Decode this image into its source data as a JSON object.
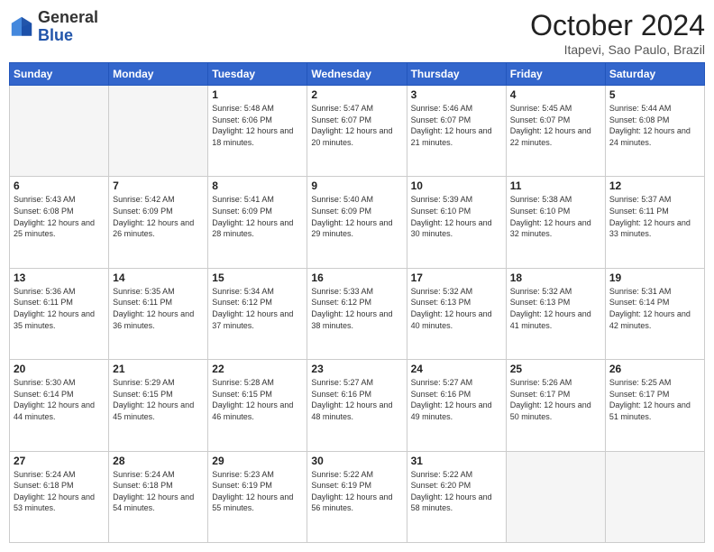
{
  "logo": {
    "general": "General",
    "blue": "Blue"
  },
  "header": {
    "month": "October 2024",
    "location": "Itapevi, Sao Paulo, Brazil"
  },
  "days_of_week": [
    "Sunday",
    "Monday",
    "Tuesday",
    "Wednesday",
    "Thursday",
    "Friday",
    "Saturday"
  ],
  "weeks": [
    [
      {
        "day": "",
        "empty": true
      },
      {
        "day": "",
        "empty": true
      },
      {
        "day": "1",
        "sunrise": "Sunrise: 5:48 AM",
        "sunset": "Sunset: 6:06 PM",
        "daylight": "Daylight: 12 hours and 18 minutes."
      },
      {
        "day": "2",
        "sunrise": "Sunrise: 5:47 AM",
        "sunset": "Sunset: 6:07 PM",
        "daylight": "Daylight: 12 hours and 20 minutes."
      },
      {
        "day": "3",
        "sunrise": "Sunrise: 5:46 AM",
        "sunset": "Sunset: 6:07 PM",
        "daylight": "Daylight: 12 hours and 21 minutes."
      },
      {
        "day": "4",
        "sunrise": "Sunrise: 5:45 AM",
        "sunset": "Sunset: 6:07 PM",
        "daylight": "Daylight: 12 hours and 22 minutes."
      },
      {
        "day": "5",
        "sunrise": "Sunrise: 5:44 AM",
        "sunset": "Sunset: 6:08 PM",
        "daylight": "Daylight: 12 hours and 24 minutes."
      }
    ],
    [
      {
        "day": "6",
        "sunrise": "Sunrise: 5:43 AM",
        "sunset": "Sunset: 6:08 PM",
        "daylight": "Daylight: 12 hours and 25 minutes."
      },
      {
        "day": "7",
        "sunrise": "Sunrise: 5:42 AM",
        "sunset": "Sunset: 6:09 PM",
        "daylight": "Daylight: 12 hours and 26 minutes."
      },
      {
        "day": "8",
        "sunrise": "Sunrise: 5:41 AM",
        "sunset": "Sunset: 6:09 PM",
        "daylight": "Daylight: 12 hours and 28 minutes."
      },
      {
        "day": "9",
        "sunrise": "Sunrise: 5:40 AM",
        "sunset": "Sunset: 6:09 PM",
        "daylight": "Daylight: 12 hours and 29 minutes."
      },
      {
        "day": "10",
        "sunrise": "Sunrise: 5:39 AM",
        "sunset": "Sunset: 6:10 PM",
        "daylight": "Daylight: 12 hours and 30 minutes."
      },
      {
        "day": "11",
        "sunrise": "Sunrise: 5:38 AM",
        "sunset": "Sunset: 6:10 PM",
        "daylight": "Daylight: 12 hours and 32 minutes."
      },
      {
        "day": "12",
        "sunrise": "Sunrise: 5:37 AM",
        "sunset": "Sunset: 6:11 PM",
        "daylight": "Daylight: 12 hours and 33 minutes."
      }
    ],
    [
      {
        "day": "13",
        "sunrise": "Sunrise: 5:36 AM",
        "sunset": "Sunset: 6:11 PM",
        "daylight": "Daylight: 12 hours and 35 minutes."
      },
      {
        "day": "14",
        "sunrise": "Sunrise: 5:35 AM",
        "sunset": "Sunset: 6:11 PM",
        "daylight": "Daylight: 12 hours and 36 minutes."
      },
      {
        "day": "15",
        "sunrise": "Sunrise: 5:34 AM",
        "sunset": "Sunset: 6:12 PM",
        "daylight": "Daylight: 12 hours and 37 minutes."
      },
      {
        "day": "16",
        "sunrise": "Sunrise: 5:33 AM",
        "sunset": "Sunset: 6:12 PM",
        "daylight": "Daylight: 12 hours and 38 minutes."
      },
      {
        "day": "17",
        "sunrise": "Sunrise: 5:32 AM",
        "sunset": "Sunset: 6:13 PM",
        "daylight": "Daylight: 12 hours and 40 minutes."
      },
      {
        "day": "18",
        "sunrise": "Sunrise: 5:32 AM",
        "sunset": "Sunset: 6:13 PM",
        "daylight": "Daylight: 12 hours and 41 minutes."
      },
      {
        "day": "19",
        "sunrise": "Sunrise: 5:31 AM",
        "sunset": "Sunset: 6:14 PM",
        "daylight": "Daylight: 12 hours and 42 minutes."
      }
    ],
    [
      {
        "day": "20",
        "sunrise": "Sunrise: 5:30 AM",
        "sunset": "Sunset: 6:14 PM",
        "daylight": "Daylight: 12 hours and 44 minutes."
      },
      {
        "day": "21",
        "sunrise": "Sunrise: 5:29 AM",
        "sunset": "Sunset: 6:15 PM",
        "daylight": "Daylight: 12 hours and 45 minutes."
      },
      {
        "day": "22",
        "sunrise": "Sunrise: 5:28 AM",
        "sunset": "Sunset: 6:15 PM",
        "daylight": "Daylight: 12 hours and 46 minutes."
      },
      {
        "day": "23",
        "sunrise": "Sunrise: 5:27 AM",
        "sunset": "Sunset: 6:16 PM",
        "daylight": "Daylight: 12 hours and 48 minutes."
      },
      {
        "day": "24",
        "sunrise": "Sunrise: 5:27 AM",
        "sunset": "Sunset: 6:16 PM",
        "daylight": "Daylight: 12 hours and 49 minutes."
      },
      {
        "day": "25",
        "sunrise": "Sunrise: 5:26 AM",
        "sunset": "Sunset: 6:17 PM",
        "daylight": "Daylight: 12 hours and 50 minutes."
      },
      {
        "day": "26",
        "sunrise": "Sunrise: 5:25 AM",
        "sunset": "Sunset: 6:17 PM",
        "daylight": "Daylight: 12 hours and 51 minutes."
      }
    ],
    [
      {
        "day": "27",
        "sunrise": "Sunrise: 5:24 AM",
        "sunset": "Sunset: 6:18 PM",
        "daylight": "Daylight: 12 hours and 53 minutes."
      },
      {
        "day": "28",
        "sunrise": "Sunrise: 5:24 AM",
        "sunset": "Sunset: 6:18 PM",
        "daylight": "Daylight: 12 hours and 54 minutes."
      },
      {
        "day": "29",
        "sunrise": "Sunrise: 5:23 AM",
        "sunset": "Sunset: 6:19 PM",
        "daylight": "Daylight: 12 hours and 55 minutes."
      },
      {
        "day": "30",
        "sunrise": "Sunrise: 5:22 AM",
        "sunset": "Sunset: 6:19 PM",
        "daylight": "Daylight: 12 hours and 56 minutes."
      },
      {
        "day": "31",
        "sunrise": "Sunrise: 5:22 AM",
        "sunset": "Sunset: 6:20 PM",
        "daylight": "Daylight: 12 hours and 58 minutes."
      },
      {
        "day": "",
        "empty": true
      },
      {
        "day": "",
        "empty": true
      }
    ]
  ]
}
